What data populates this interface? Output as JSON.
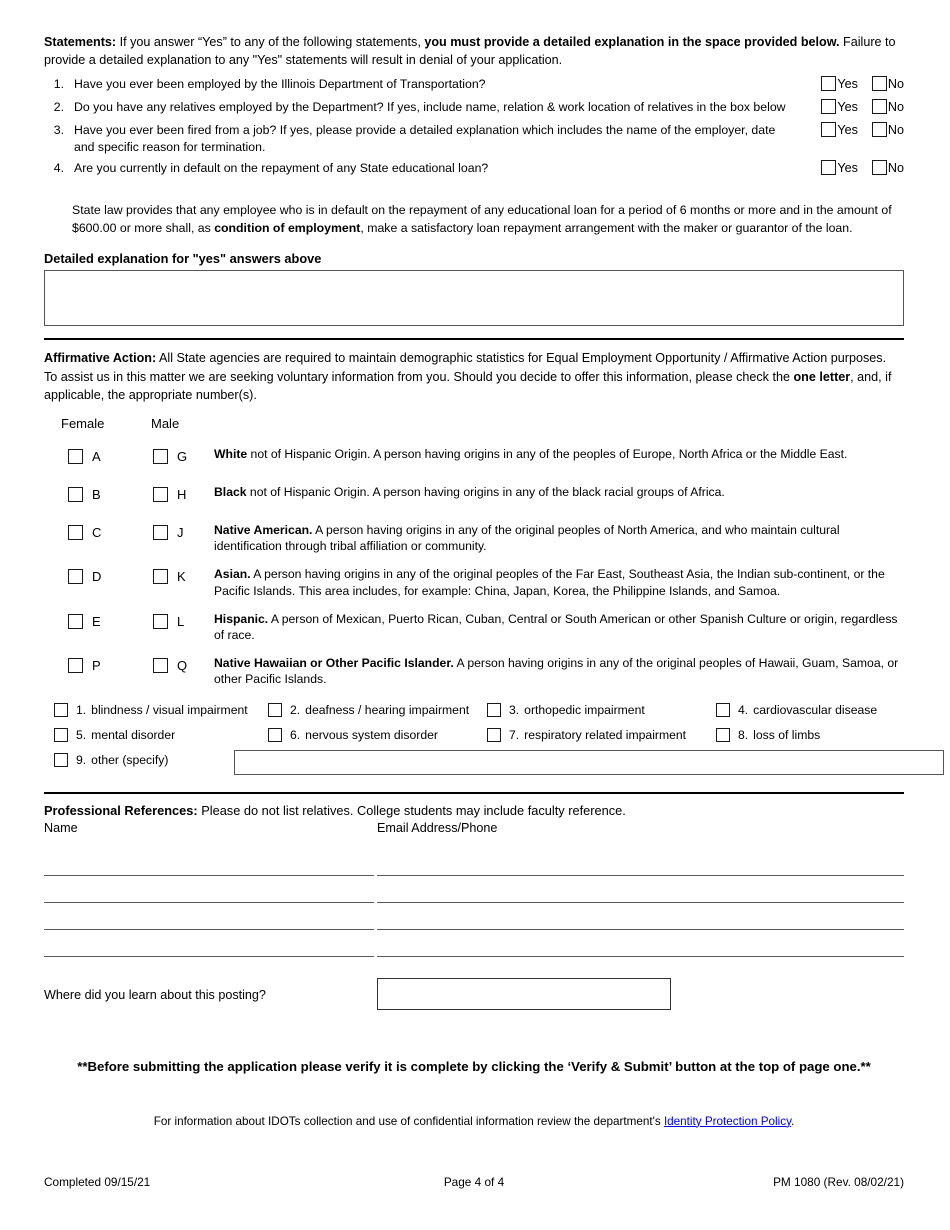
{
  "statements": {
    "heading": "Statements:",
    "intro_part1": " If you answer “Yes” to any of the following statements, ",
    "intro_bold": "you must provide a detailed explanation in the space provided below.",
    "intro_part2": " Failure to provide a detailed explanation to any \"Yes\" statements will result in denial of your application.",
    "yes_label": "Yes",
    "no_label": "No",
    "items": [
      {
        "num": "1.",
        "text": "Have you ever been employed by the Illinois Department of Transportation?"
      },
      {
        "num": "2.",
        "text": "Do you have any relatives employed by the Department? If yes, include name, relation & work location of relatives in the box below"
      },
      {
        "num": "3.",
        "text": "Have you ever been fired from a job? If yes, please provide a detailed explanation which includes the name of the employer, date and specific reason for termination."
      },
      {
        "num": "4.",
        "text": "Are you currently in default on the repayment of any State educational loan?"
      }
    ],
    "loan_note_a": "State law provides that any employee who is in default on the repayment of any educational loan for a period of 6 months or more and in the amount of $600.00 or more shall, as ",
    "loan_note_bold": "condition of employment",
    "loan_note_b": ", make a satisfactory loan repayment arrangement with the maker or guarantor of the loan.",
    "explanation_label": "Detailed explanation for \"yes\" answers above",
    "explanation_value": ""
  },
  "affirmative_action": {
    "heading": "Affirmative Action:",
    "intro_a": "  All State agencies are required to maintain demographic statistics for Equal Employment Opportunity / Affirmative Action purposes.  To assist us in this matter we are seeking voluntary information from you.  Should you decide to offer this information, please check the ",
    "intro_bold": "one letter",
    "intro_b": ", and, if applicable, the appropriate number(s).",
    "female_label": "Female",
    "male_label": "Male",
    "ethnicities": [
      {
        "female_letter": "A",
        "male_letter": "G",
        "term": "White",
        "desc": " not of Hispanic Origin.  A person having origins in any of the peoples of Europe, North Africa or the Middle East."
      },
      {
        "female_letter": "B",
        "male_letter": "H",
        "term": "Black",
        "desc": " not of Hispanic Origin.  A person having origins in any of the black racial groups of Africa."
      },
      {
        "female_letter": "C",
        "male_letter": "J",
        "term": "Native American.",
        "desc": "  A person having origins in any of the original peoples of North America, and who maintain cultural identification through tribal affiliation or community."
      },
      {
        "female_letter": "D",
        "male_letter": "K",
        "term": "Asian.",
        "desc": "  A person having origins in any of the original peoples of the Far East, Southeast Asia, the Indian sub-continent, or the Pacific Islands.  This area includes, for example:  China, Japan, Korea, the Philippine Islands, and Samoa."
      },
      {
        "female_letter": "E",
        "male_letter": "L",
        "term": "Hispanic.",
        "desc": "  A person of Mexican, Puerto Rican, Cuban, Central or South American or other Spanish Culture or origin, regardless of race."
      },
      {
        "female_letter": "P",
        "male_letter": "Q",
        "term": "Native Hawaiian or Other Pacific Islander.",
        "desc": "  A person having origins in any of the original peoples of Hawaii, Guam, Samoa, or other Pacific Islands."
      }
    ],
    "disabilities": [
      {
        "num": "1.",
        "label": "blindness / visual impairment"
      },
      {
        "num": "2.",
        "label": "deafness / hearing impairment"
      },
      {
        "num": "3.",
        "label": "orthopedic impairment"
      },
      {
        "num": "4.",
        "label": "cardiovascular disease"
      },
      {
        "num": "5.",
        "label": "mental disorder"
      },
      {
        "num": "6.",
        "label": "nervous system disorder"
      },
      {
        "num": "7.",
        "label": "respiratory related impairment"
      },
      {
        "num": "8.",
        "label": "loss of limbs"
      },
      {
        "num": "9.",
        "label": "other (specify)"
      }
    ],
    "other_value": ""
  },
  "references": {
    "heading": "Professional References:",
    "heading_rest": "  Please do not list relatives.  College students may include faculty reference.",
    "col_name": "Name",
    "col_email": "Email Address/Phone",
    "rows": [
      {
        "name": "",
        "email": ""
      },
      {
        "name": "",
        "email": ""
      },
      {
        "name": "",
        "email": ""
      },
      {
        "name": "",
        "email": ""
      }
    ]
  },
  "posting": {
    "question": "Where did you learn about this posting?",
    "value": ""
  },
  "notices": {
    "verify": "**Before submitting the application please verify it is complete by clicking the ‘Verify & Submit’ button at the top of page one.**",
    "privacy_prefix": "For information about IDOTs collection and use of confidential information review the department's ",
    "privacy_link": "Identity Protection Policy",
    "privacy_suffix": "."
  },
  "footer": {
    "completed": "Completed 09/15/21",
    "page": "Page 4 of 4",
    "form_id": "PM 1080 (Rev. 08/02/21)"
  },
  "colors": {
    "text": "#000000",
    "link": "#0000dd",
    "box_border": "#555555",
    "rule": "#000000"
  }
}
